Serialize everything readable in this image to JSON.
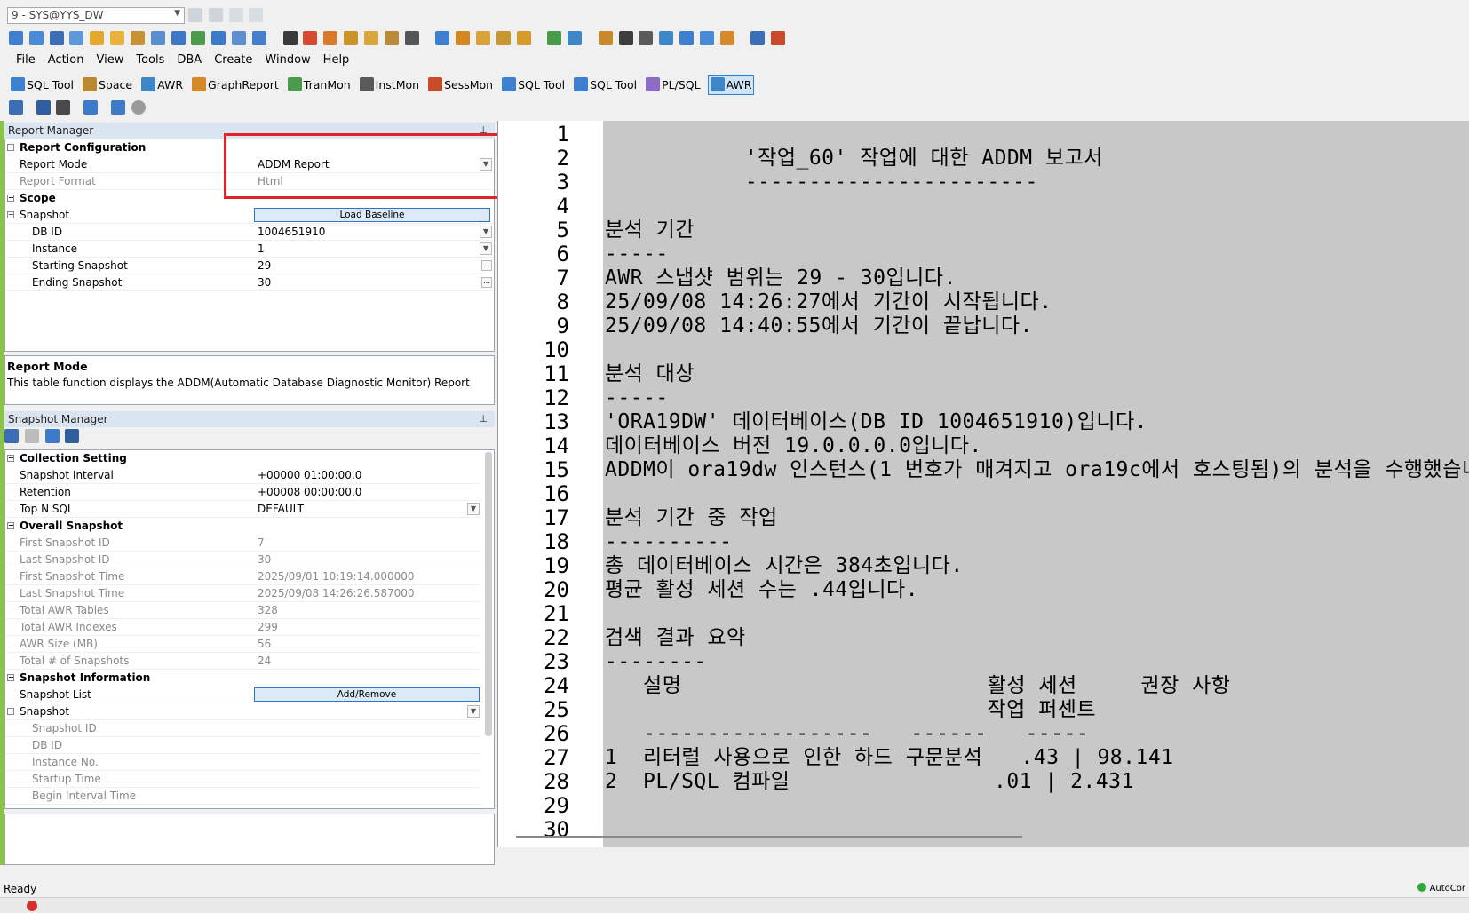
{
  "connection": {
    "selected": "9 - SYS@YYS_DW"
  },
  "menu": [
    "File",
    "Action",
    "View",
    "Tools",
    "DBA",
    "Create",
    "Window",
    "Help"
  ],
  "tool_tabs": [
    {
      "label": "SQL Tool",
      "icon": "sql-tool-icon",
      "active": false
    },
    {
      "label": "Space",
      "icon": "space-icon",
      "active": false
    },
    {
      "label": "AWR",
      "icon": "awr-icon",
      "active": false
    },
    {
      "label": "GraphReport",
      "icon": "graph-report-icon",
      "active": false
    },
    {
      "label": "TranMon",
      "icon": "tranmon-icon",
      "active": false
    },
    {
      "label": "InstMon",
      "icon": "instmon-icon",
      "active": false
    },
    {
      "label": "SessMon",
      "icon": "sessmon-icon",
      "active": false
    },
    {
      "label": "SQL Tool",
      "icon": "sql-tool-icon",
      "active": false
    },
    {
      "label": "SQL Tool",
      "icon": "sql-tool-icon",
      "active": false
    },
    {
      "label": "PL/SQL",
      "icon": "plsql-icon",
      "active": false
    },
    {
      "label": "AWR",
      "icon": "awr-icon",
      "active": true
    }
  ],
  "report_manager": {
    "title": "Report Manager",
    "report_configuration": {
      "label": "Report Configuration",
      "report_mode_label": "Report Mode",
      "report_mode_value": "ADDM Report",
      "report_format_label": "Report Format",
      "report_format_value": "Html"
    },
    "scope": {
      "label": "Scope",
      "snapshot_label": "Snapshot",
      "load_baseline_button": "Load Baseline",
      "db_id_label": "DB ID",
      "db_id_value": "1004651910",
      "instance_label": "Instance",
      "instance_value": "1",
      "starting_snapshot_label": "Starting Snapshot",
      "starting_snapshot_value": "29",
      "ending_snapshot_label": "Ending Snapshot",
      "ending_snapshot_value": "30"
    },
    "help": {
      "title": "Report Mode",
      "text": "This table function displays the ADDM(Automatic Database Diagnostic Monitor) Report"
    }
  },
  "snapshot_manager": {
    "title": "Snapshot Manager",
    "collection_setting": {
      "label": "Collection Setting",
      "rows": [
        {
          "k": "Snapshot Interval",
          "v": "+00000 01:00:00.0"
        },
        {
          "k": "Retention",
          "v": "+00008 00:00:00.0"
        },
        {
          "k": "Top N SQL",
          "v": "DEFAULT"
        }
      ]
    },
    "overall_snapshot": {
      "label": "Overall Snapshot",
      "rows": [
        {
          "k": "First Snapshot ID",
          "v": "7"
        },
        {
          "k": "Last Snapshot ID",
          "v": "30"
        },
        {
          "k": "First Snapshot Time",
          "v": "2025/09/01 10:19:14.000000"
        },
        {
          "k": "Last Snapshot Time",
          "v": "2025/09/08 14:26:26.587000"
        },
        {
          "k": "Total AWR Tables",
          "v": "328"
        },
        {
          "k": "Total AWR Indexes",
          "v": "299"
        },
        {
          "k": "AWR Size (MB)",
          "v": "56"
        },
        {
          "k": "Total # of Snapshots",
          "v": "24"
        }
      ]
    },
    "snapshot_information": {
      "label": "Snapshot Information",
      "snapshot_list_label": "Snapshot List",
      "add_remove_button": "Add/Remove",
      "snapshot_label": "Snapshot",
      "sub_rows": [
        "Snapshot ID",
        "DB ID",
        "Instance No.",
        "Startup Time",
        "Begin Interval Time"
      ]
    }
  },
  "editor": {
    "line_numbers": [
      "1",
      "2",
      "3",
      "4",
      "5",
      "6",
      "7",
      "8",
      "9",
      "10",
      "11",
      "12",
      "13",
      "14",
      "15",
      "16",
      "17",
      "18",
      "19",
      "20",
      "21",
      "22",
      "23",
      "24",
      "25",
      "26",
      "27",
      "28",
      "29",
      "30"
    ],
    "lines": [
      "",
      "           '작업_60' 작업에 대한 ADDM 보고서",
      "           -----------------------",
      "",
      "분석 기간",
      "-----",
      "AWR 스냅샷 범위는 29 - 30입니다.",
      "25/09/08 14:26:27에서 기간이 시작됩니다.",
      "25/09/08 14:40:55에서 기간이 끝납니다.",
      "",
      "분석 대상",
      "-----",
      "'ORA19DW' 데이터베이스(DB ID 1004651910)입니다.",
      "데이터베이스 버전 19.0.0.0.0입니다.",
      "ADDM이 ora19dw 인스턴스(1 번호가 매겨지고 ora19c에서 호스팅됨)의 분석을 수행했습니",
      "",
      "분석 기간 중 작업",
      "----------",
      "총 데이터베이스 시간은 384초입니다.",
      "평균 활성 세션 수는 .44입니다.",
      "",
      "검색 결과 요약",
      "--------",
      "   설명                        활성 세션     권장 사항",
      "                              작업 퍼센트",
      "   ------------------   ------   -----",
      "1  리터럴 사용으로 인한 하드 구문분석   .43 | 98.141",
      "2  PL/SQL 컴파일                .01 | 2.431",
      "",
      ""
    ]
  },
  "status": {
    "text": "Ready",
    "autocommit": "AutoCor"
  },
  "colors": {
    "highlight": "#e02323",
    "active_tab": "#cfe4f7",
    "editor_bg": "#c8c8c8",
    "panel_head": "#dbe5f1"
  }
}
